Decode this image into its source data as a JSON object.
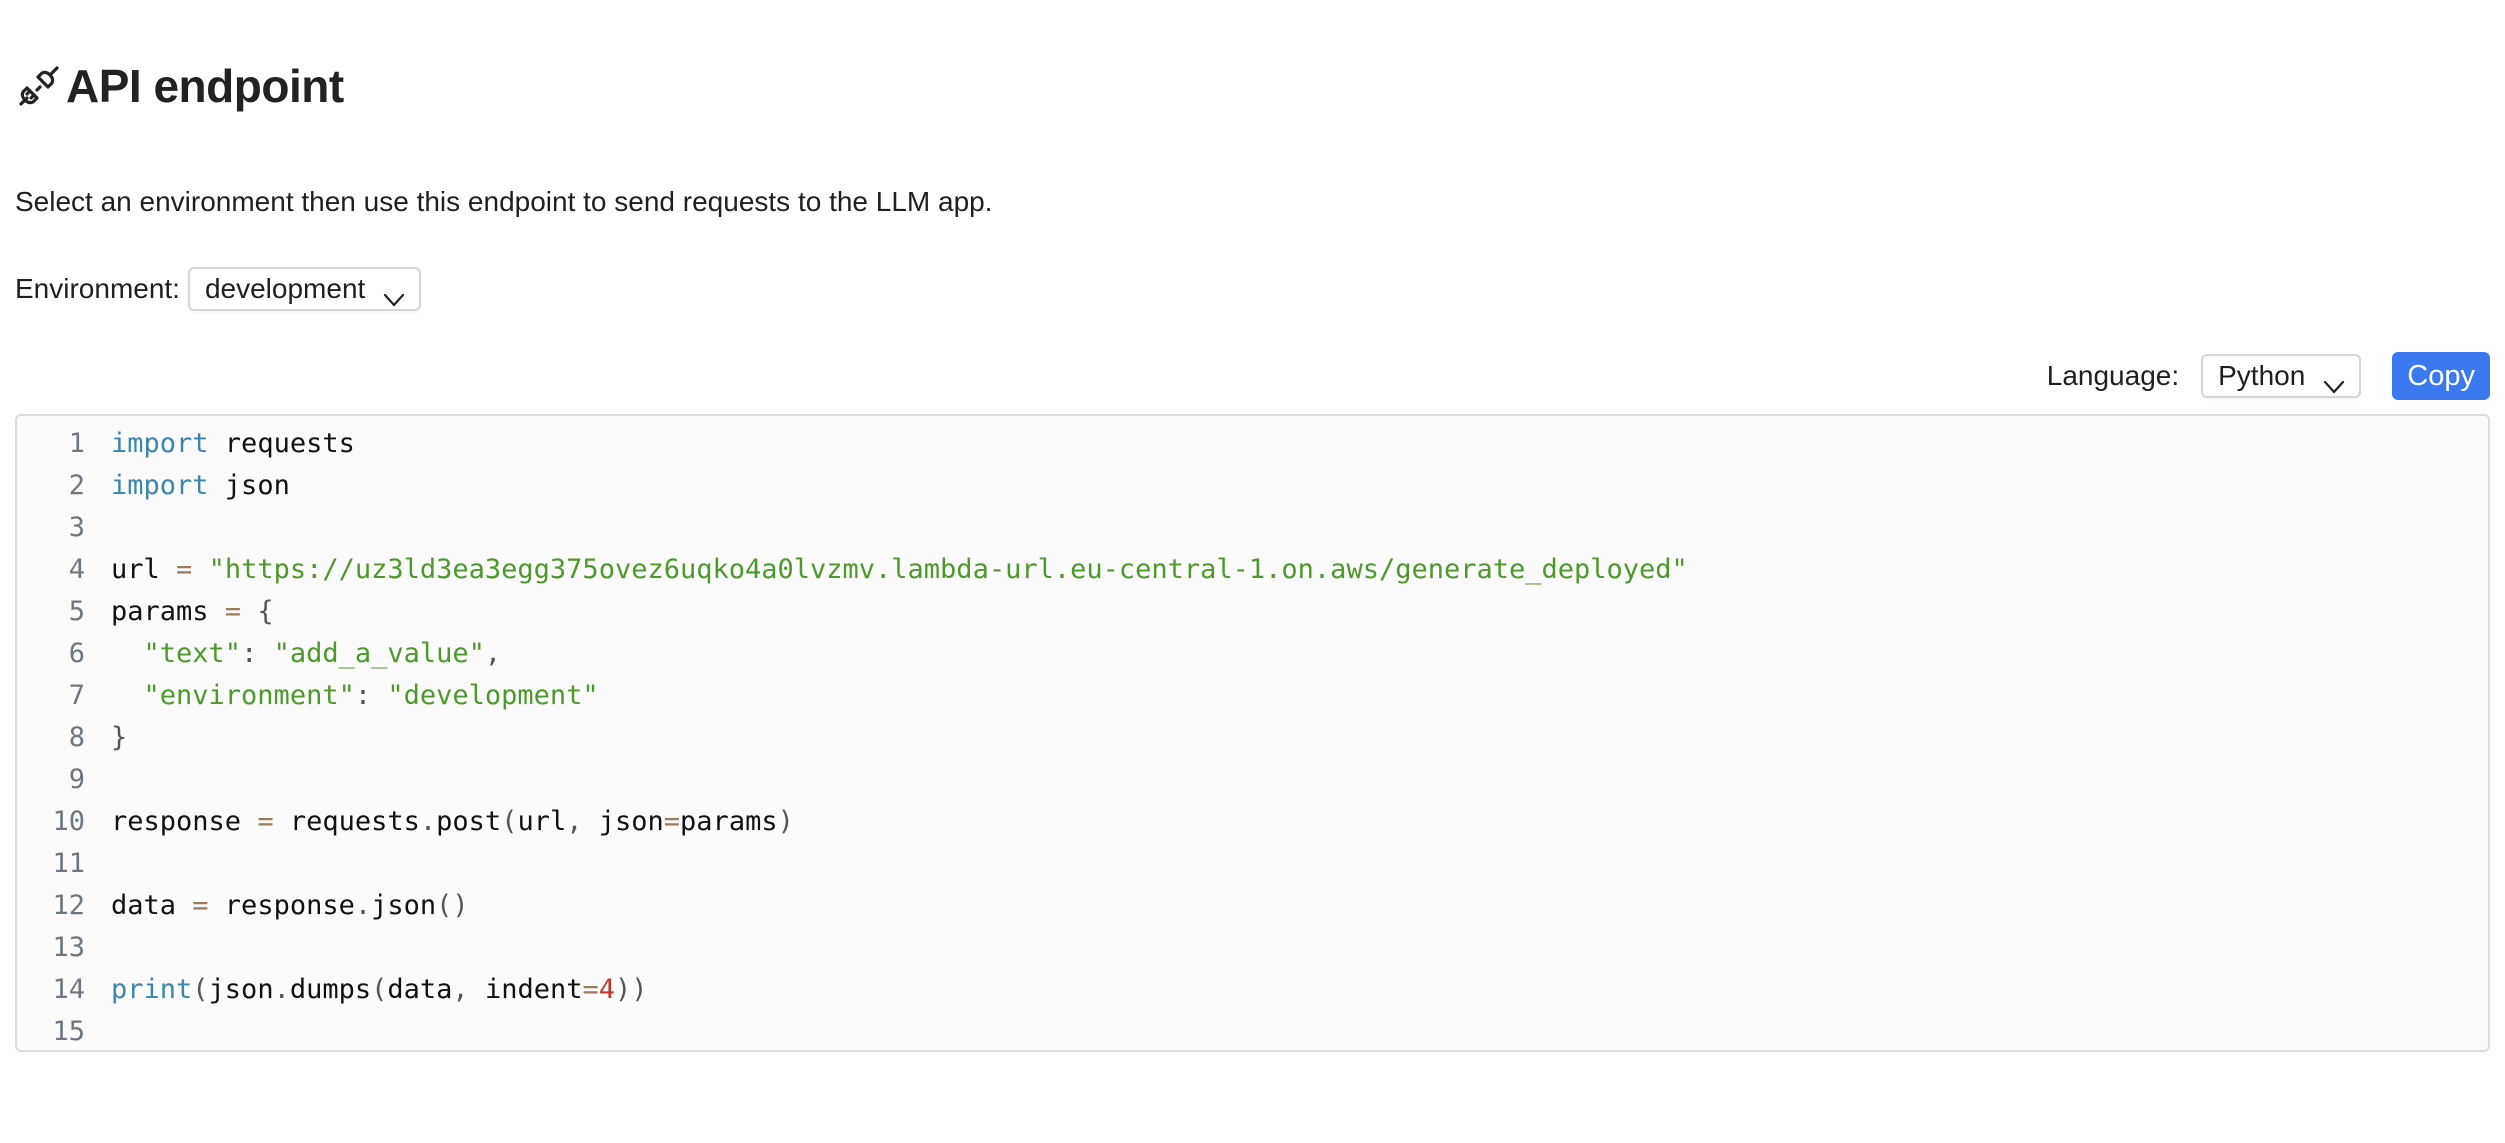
{
  "header": {
    "icon": "plug-icon",
    "title": "API endpoint"
  },
  "description": "Select an environment then use this endpoint to send requests to the LLM app.",
  "environment": {
    "label": "Environment:",
    "selected": "development"
  },
  "toolbar": {
    "language_label": "Language:",
    "language_selected": "Python",
    "copy_label": "Copy"
  },
  "colors": {
    "copy_button": "#3b79f0",
    "keyword": "#3a86b0",
    "string": "#4c9a2a",
    "operator": "#9a7b55",
    "number": "#c0392b",
    "line_number": "#6e7781"
  },
  "code": {
    "lines": [
      [
        {
          "t": "kw",
          "v": "import"
        },
        {
          "t": "",
          "v": " requests"
        }
      ],
      [
        {
          "t": "kw",
          "v": "import"
        },
        {
          "t": "",
          "v": " json"
        }
      ],
      [],
      [
        {
          "t": "",
          "v": "url "
        },
        {
          "t": "op",
          "v": "="
        },
        {
          "t": "",
          "v": " "
        },
        {
          "t": "str",
          "v": "\"https://uz3ld3ea3egg375ovez6uqko4a0lvzmv.lambda-url.eu-central-1.on.aws/generate_deployed\""
        }
      ],
      [
        {
          "t": "",
          "v": "params "
        },
        {
          "t": "op",
          "v": "="
        },
        {
          "t": "",
          "v": " "
        },
        {
          "t": "pn",
          "v": "{"
        }
      ],
      [
        {
          "t": "",
          "v": "  "
        },
        {
          "t": "str",
          "v": "\"text\""
        },
        {
          "t": "pn",
          "v": ": "
        },
        {
          "t": "str",
          "v": "\"add_a_value\""
        },
        {
          "t": "pn",
          "v": ","
        }
      ],
      [
        {
          "t": "",
          "v": "  "
        },
        {
          "t": "str",
          "v": "\"environment\""
        },
        {
          "t": "pn",
          "v": ": "
        },
        {
          "t": "str",
          "v": "\"development\""
        }
      ],
      [
        {
          "t": "pn",
          "v": "}"
        }
      ],
      [],
      [
        {
          "t": "",
          "v": "response "
        },
        {
          "t": "op",
          "v": "="
        },
        {
          "t": "",
          "v": " requests"
        },
        {
          "t": "pn",
          "v": "."
        },
        {
          "t": "",
          "v": "post"
        },
        {
          "t": "pn",
          "v": "("
        },
        {
          "t": "",
          "v": "url"
        },
        {
          "t": "pn",
          "v": ", "
        },
        {
          "t": "",
          "v": "json"
        },
        {
          "t": "op",
          "v": "="
        },
        {
          "t": "",
          "v": "params"
        },
        {
          "t": "pn",
          "v": ")"
        }
      ],
      [],
      [
        {
          "t": "",
          "v": "data "
        },
        {
          "t": "op",
          "v": "="
        },
        {
          "t": "",
          "v": " response"
        },
        {
          "t": "pn",
          "v": "."
        },
        {
          "t": "",
          "v": "json"
        },
        {
          "t": "pn",
          "v": "()"
        }
      ],
      [],
      [
        {
          "t": "kw",
          "v": "print"
        },
        {
          "t": "pn",
          "v": "("
        },
        {
          "t": "",
          "v": "json"
        },
        {
          "t": "pn",
          "v": "."
        },
        {
          "t": "",
          "v": "dumps"
        },
        {
          "t": "pn",
          "v": "("
        },
        {
          "t": "",
          "v": "data"
        },
        {
          "t": "pn",
          "v": ", "
        },
        {
          "t": "",
          "v": "indent"
        },
        {
          "t": "op",
          "v": "="
        },
        {
          "t": "num",
          "v": "4"
        },
        {
          "t": "pn",
          "v": "))"
        }
      ],
      []
    ]
  }
}
